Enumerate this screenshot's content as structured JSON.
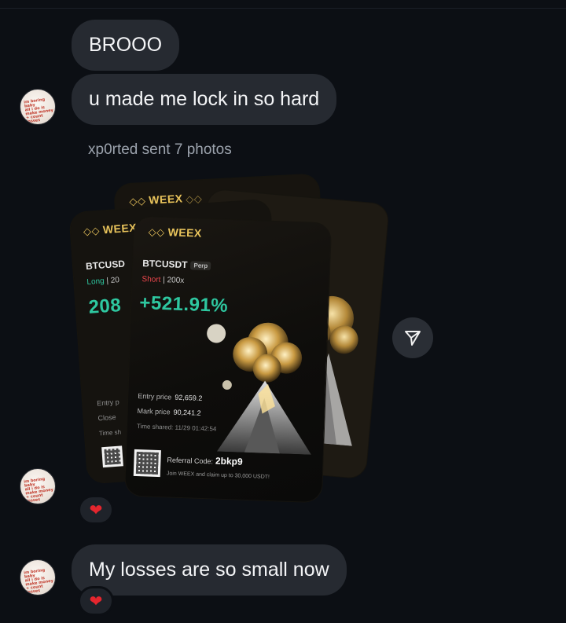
{
  "messages": [
    {
      "text": "BROOO"
    },
    {
      "text": "u made me lock in so hard"
    }
  ],
  "sent_note": "xp0rted sent 7 photos",
  "avatar": {
    "label": "im boring baby all i do is make money + count losses"
  },
  "photo_card": {
    "brand": "WEEX",
    "pair_back": "BTCUSD",
    "side_back": "Long",
    "lev_back": "20",
    "pnl_back": "208",
    "pair": "BTCUSDT",
    "perp": "Perp",
    "side": "Short",
    "leverage": "200x",
    "pnl": "+521.91%",
    "entry_label": "Entry price",
    "entry_value": "92,659.2",
    "mark_label": "Mark price",
    "mark_value": "90,241.2",
    "time_label": "Time shared:",
    "time_value": "11/29 01:42:54",
    "entry_back": "Entry p",
    "mark_back": "Close",
    "time_back": "Time sh",
    "referral_label": "Referral Code:",
    "referral_code": "2bkp9",
    "join_text": "Join WEEX and claim up to 30,000 USDT!"
  },
  "reactions": [
    "❤",
    "❤"
  ],
  "last_message": "My losses are so small now",
  "colors": {
    "background": "#0c0f14",
    "bubble": "#262a31",
    "gain": "#2ec7a0",
    "short": "#e8454b",
    "long": "#2ec7a0",
    "brand": "#e8c35b"
  }
}
